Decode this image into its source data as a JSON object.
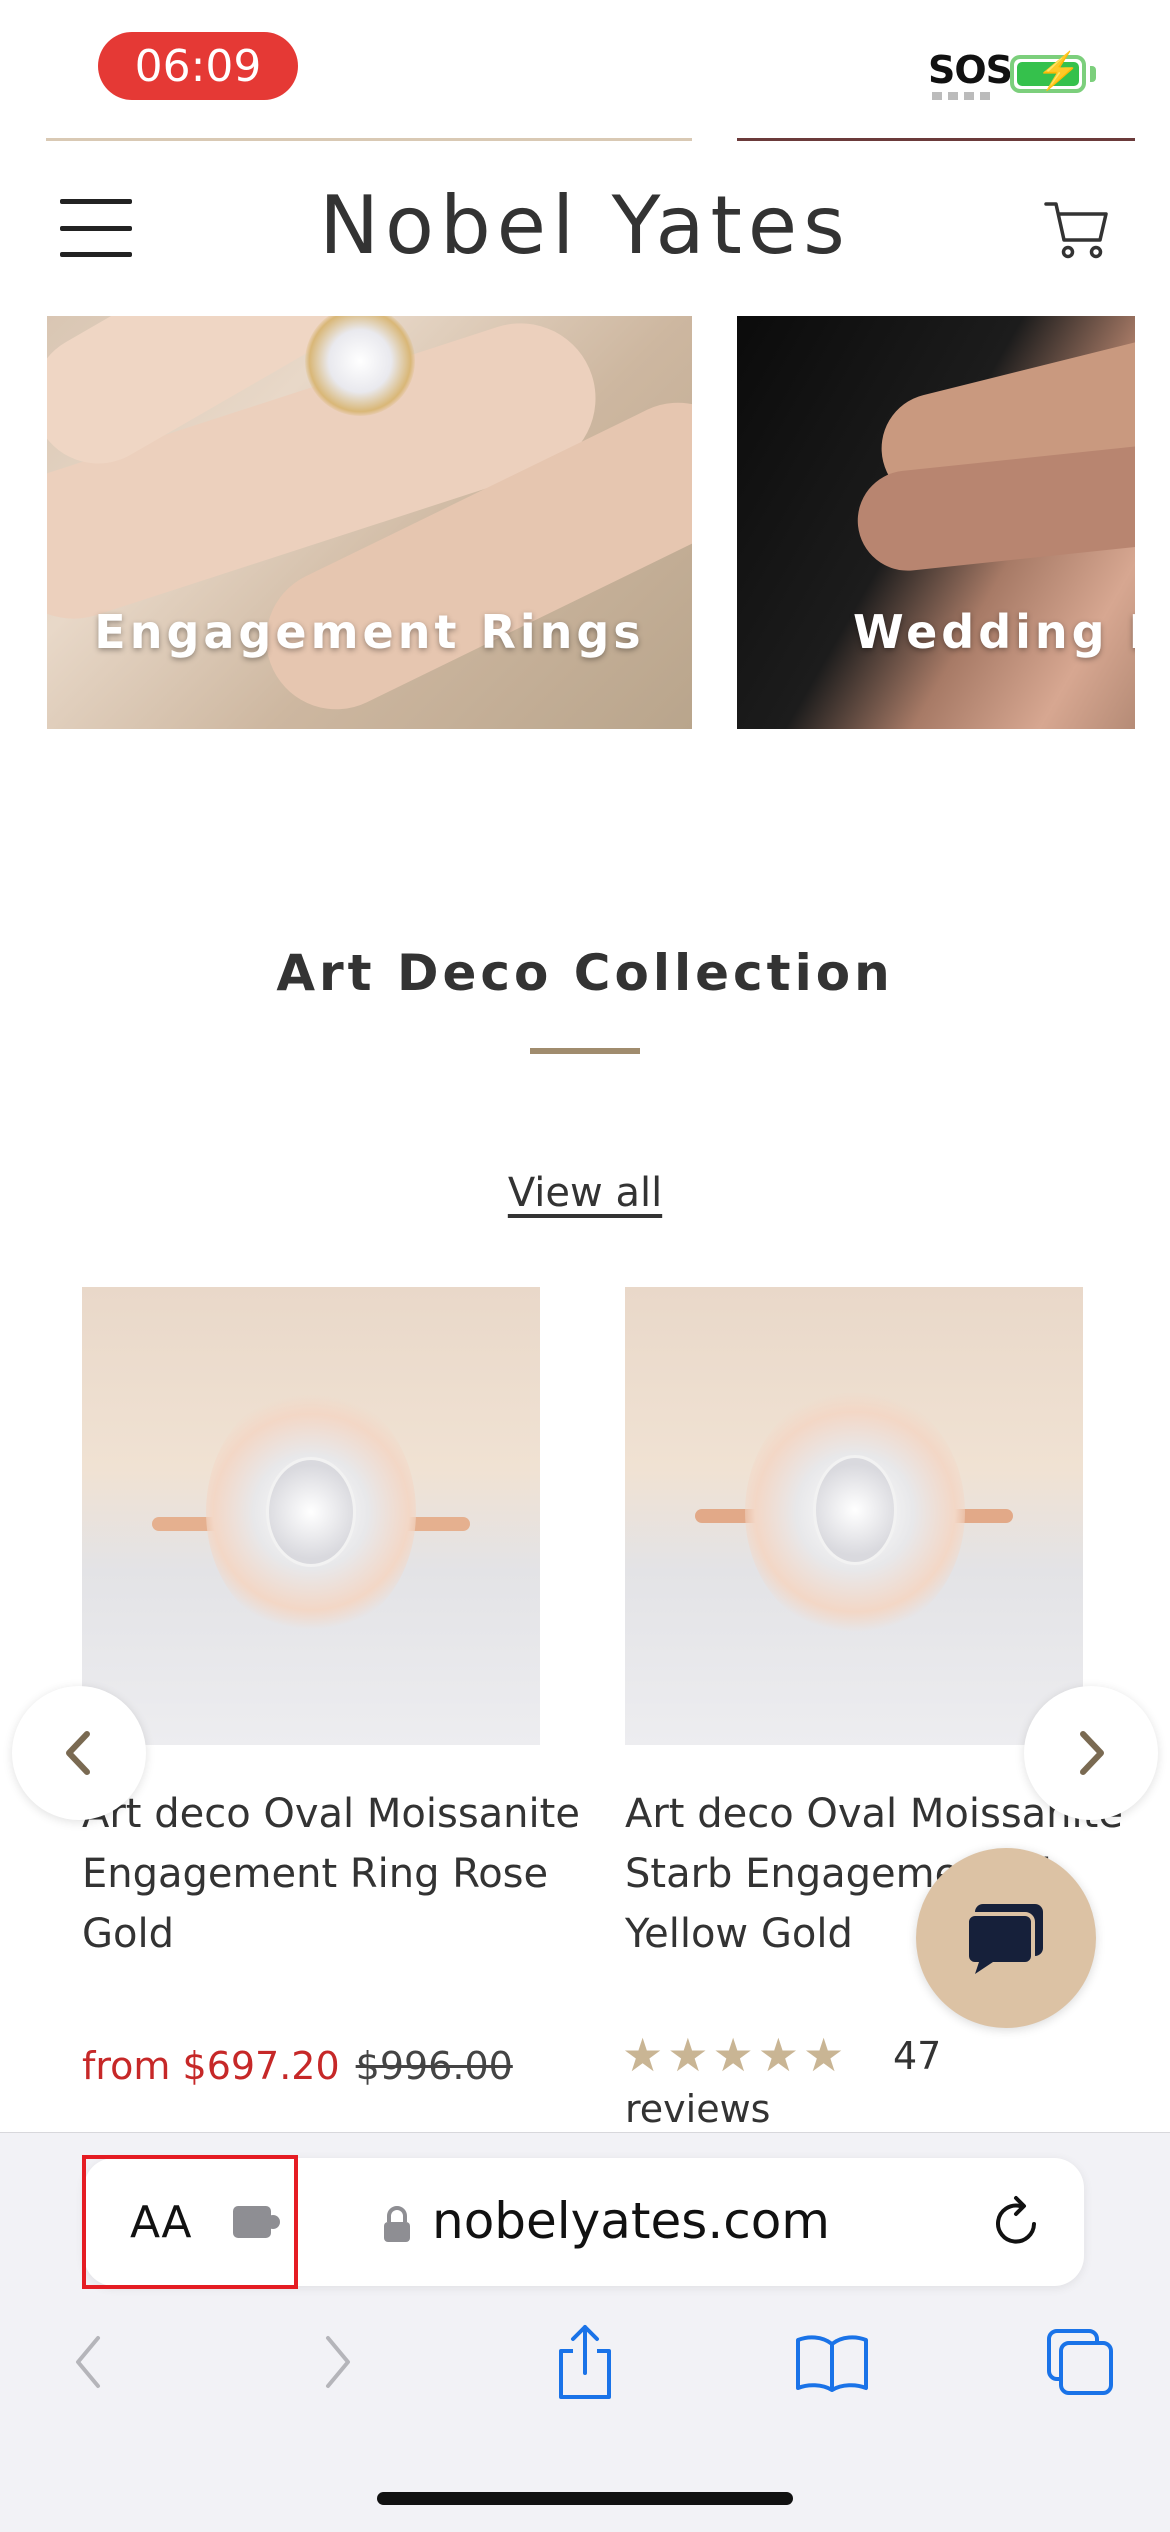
{
  "status_bar": {
    "time": "06:09",
    "sos": "SOS"
  },
  "header": {
    "brand": "Nobel Yates"
  },
  "categories": [
    {
      "label": "Engagement Rings"
    },
    {
      "label": "Wedding B"
    }
  ],
  "section": {
    "title": "Art Deco Collection",
    "view_all": "View all"
  },
  "products": [
    {
      "title": "Art deco Oval Moissanite Engagement Ring Rose Gold",
      "price_sale": "from $697.20",
      "price_original": "$996.00"
    },
    {
      "title": "Art deco Oval Moissanite Starb Engagement Ri Yellow Gold",
      "rating_stars": 5,
      "review_count": "47",
      "review_word": "reviews"
    }
  ],
  "browser": {
    "aa_label": "AA",
    "url": "nobelyates.com"
  },
  "colors": {
    "accent_tan": "#dcc2a4",
    "rule": "#a08c6e",
    "sale_red": "#c62828",
    "star": "#c9b594",
    "time_pill": "#e53935",
    "safari_blue": "#1a73e8"
  }
}
